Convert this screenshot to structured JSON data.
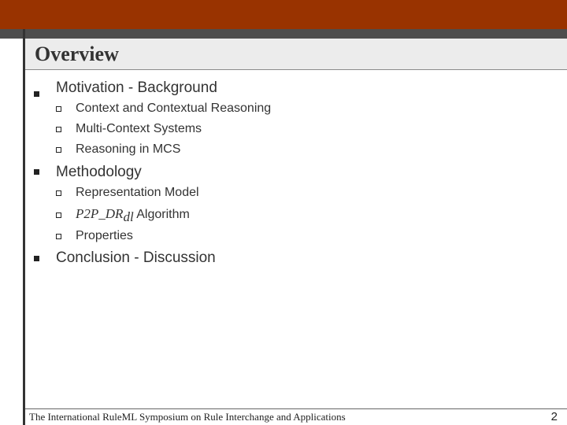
{
  "slide": {
    "title": "Overview",
    "outline": [
      {
        "label": "Motivation - Background",
        "subitems": [
          "Context and Contextual Reasoning",
          "Multi-Context Systems",
          "Reasoning in MCS"
        ]
      },
      {
        "label": "Methodology",
        "subitems": [
          "Representation Model",
          "Properties"
        ],
        "algorithm_item": {
          "symbol": "P2P_DR",
          "subscript": "dl",
          "suffix": " Algorithm"
        }
      },
      {
        "label": "Conclusion - Discussion",
        "subitems": []
      }
    ]
  },
  "footer": {
    "text": "The International RuleML Symposium on Rule Interchange and Applications",
    "page_number": "2"
  },
  "colors": {
    "header_bar": "#993300",
    "header_strip": "#4d4d4d",
    "title_band": "#ececec",
    "text": "#333333"
  }
}
